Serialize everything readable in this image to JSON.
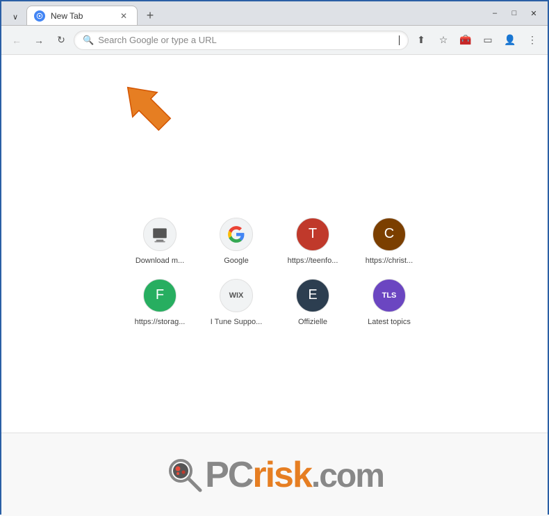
{
  "titlebar": {
    "tab_title": "New Tab",
    "new_tab_label": "+",
    "minimize_label": "–",
    "maximize_label": "□",
    "close_label": "✕",
    "chevron_down": "∨"
  },
  "navbar": {
    "back_title": "Back",
    "forward_title": "Forward",
    "reload_title": "Reload",
    "search_placeholder": "Search Google or type a URL",
    "share_title": "Share",
    "bookmark_title": "Bookmark",
    "extensions_title": "Extensions",
    "cast_title": "Cast",
    "profile_title": "Profile",
    "menu_title": "Menu"
  },
  "shortcuts": [
    {
      "id": "download-manager",
      "label": "Download m...",
      "icon_type": "download",
      "icon_text": "🖨"
    },
    {
      "id": "google",
      "label": "Google",
      "icon_type": "google",
      "icon_text": "G"
    },
    {
      "id": "teenfo",
      "label": "https://teenfo...",
      "icon_type": "teen",
      "icon_text": "T"
    },
    {
      "id": "christ",
      "label": "https://christ...",
      "icon_type": "christ",
      "icon_text": "C"
    },
    {
      "id": "storage",
      "label": "https://storag...",
      "icon_type": "storage",
      "icon_text": "F"
    },
    {
      "id": "itune",
      "label": "I Tune Suppo...",
      "icon_type": "wix",
      "icon_text": "WIX"
    },
    {
      "id": "offizielle",
      "label": "Offizielle",
      "icon_type": "offizielle",
      "icon_text": "E"
    },
    {
      "id": "latest",
      "label": "Latest topics",
      "icon_type": "tls",
      "icon_text": "TLS"
    }
  ],
  "logo": {
    "pc_text": "PC",
    "risk_text": "risk",
    "dot_com_text": ".com"
  }
}
